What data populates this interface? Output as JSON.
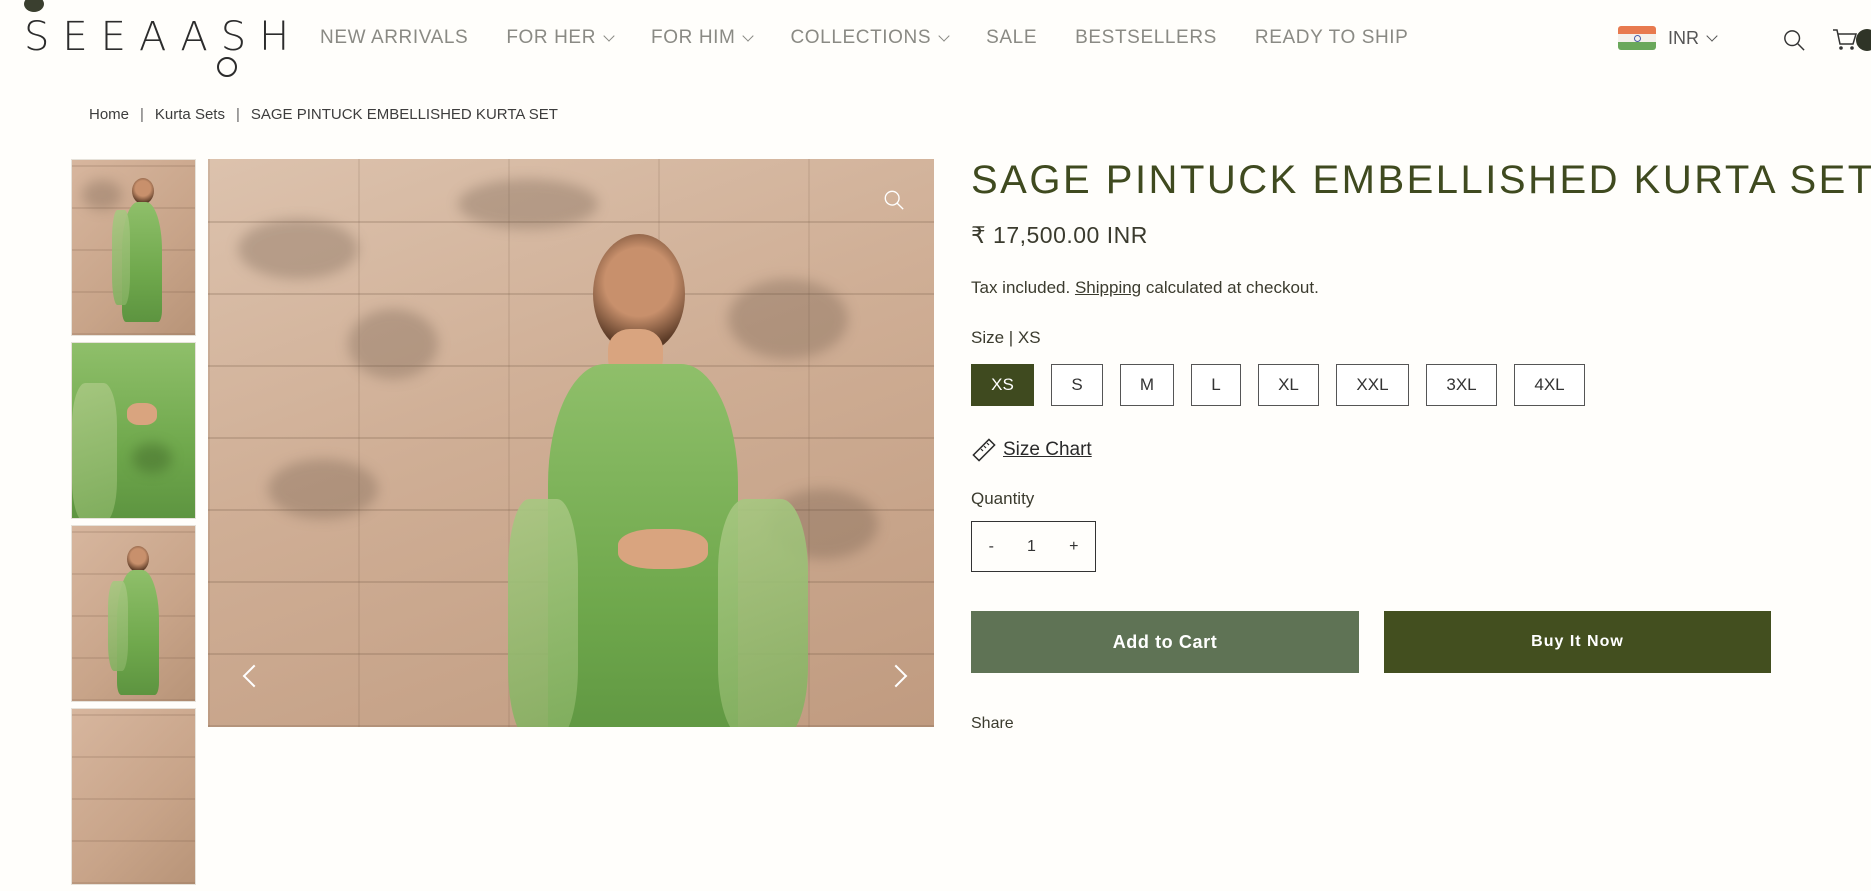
{
  "brand": {
    "name": "SEEAASH"
  },
  "nav": {
    "items": [
      {
        "label": "NEW ARRIVALS",
        "dropdown": false
      },
      {
        "label": "FOR HER",
        "dropdown": true
      },
      {
        "label": "FOR HIM",
        "dropdown": true
      },
      {
        "label": "COLLECTIONS",
        "dropdown": true
      },
      {
        "label": "SALE",
        "dropdown": false
      },
      {
        "label": "BESTSELLERS",
        "dropdown": false
      },
      {
        "label": "READY TO SHIP",
        "dropdown": false
      }
    ]
  },
  "header": {
    "currency": "INR",
    "icons": [
      "india-flag-icon",
      "search-icon",
      "cart-icon"
    ]
  },
  "breadcrumb": {
    "items": [
      "Home",
      "Kurta Sets",
      "SAGE PINTUCK EMBELLISHED KURTA SET"
    ]
  },
  "product": {
    "title": "SAGE PINTUCK EMBELLISHED KURTA SET",
    "price": "₹ 17,500.00 INR",
    "tax_prefix": "Tax included.",
    "tax_link": "Shipping",
    "tax_suffix": "calculated at checkout.",
    "size_label": "Size | XS",
    "sizes": [
      "XS",
      "S",
      "M",
      "L",
      "XL",
      "XXL",
      "3XL",
      "4XL"
    ],
    "selected_size": "XS",
    "size_chart_label": "Size Chart",
    "quantity_label": "Quantity",
    "quantity": "1",
    "qty_minus": "-",
    "qty_plus": "+",
    "add_to_cart": "Add to Cart",
    "buy_now": "Buy It Now",
    "share_label": "Share"
  },
  "colors": {
    "accent": "#3f4a1f",
    "add_to_cart_bg": "#5f7355",
    "buy_now_bg": "#434f1f",
    "background": "#fffefb"
  }
}
